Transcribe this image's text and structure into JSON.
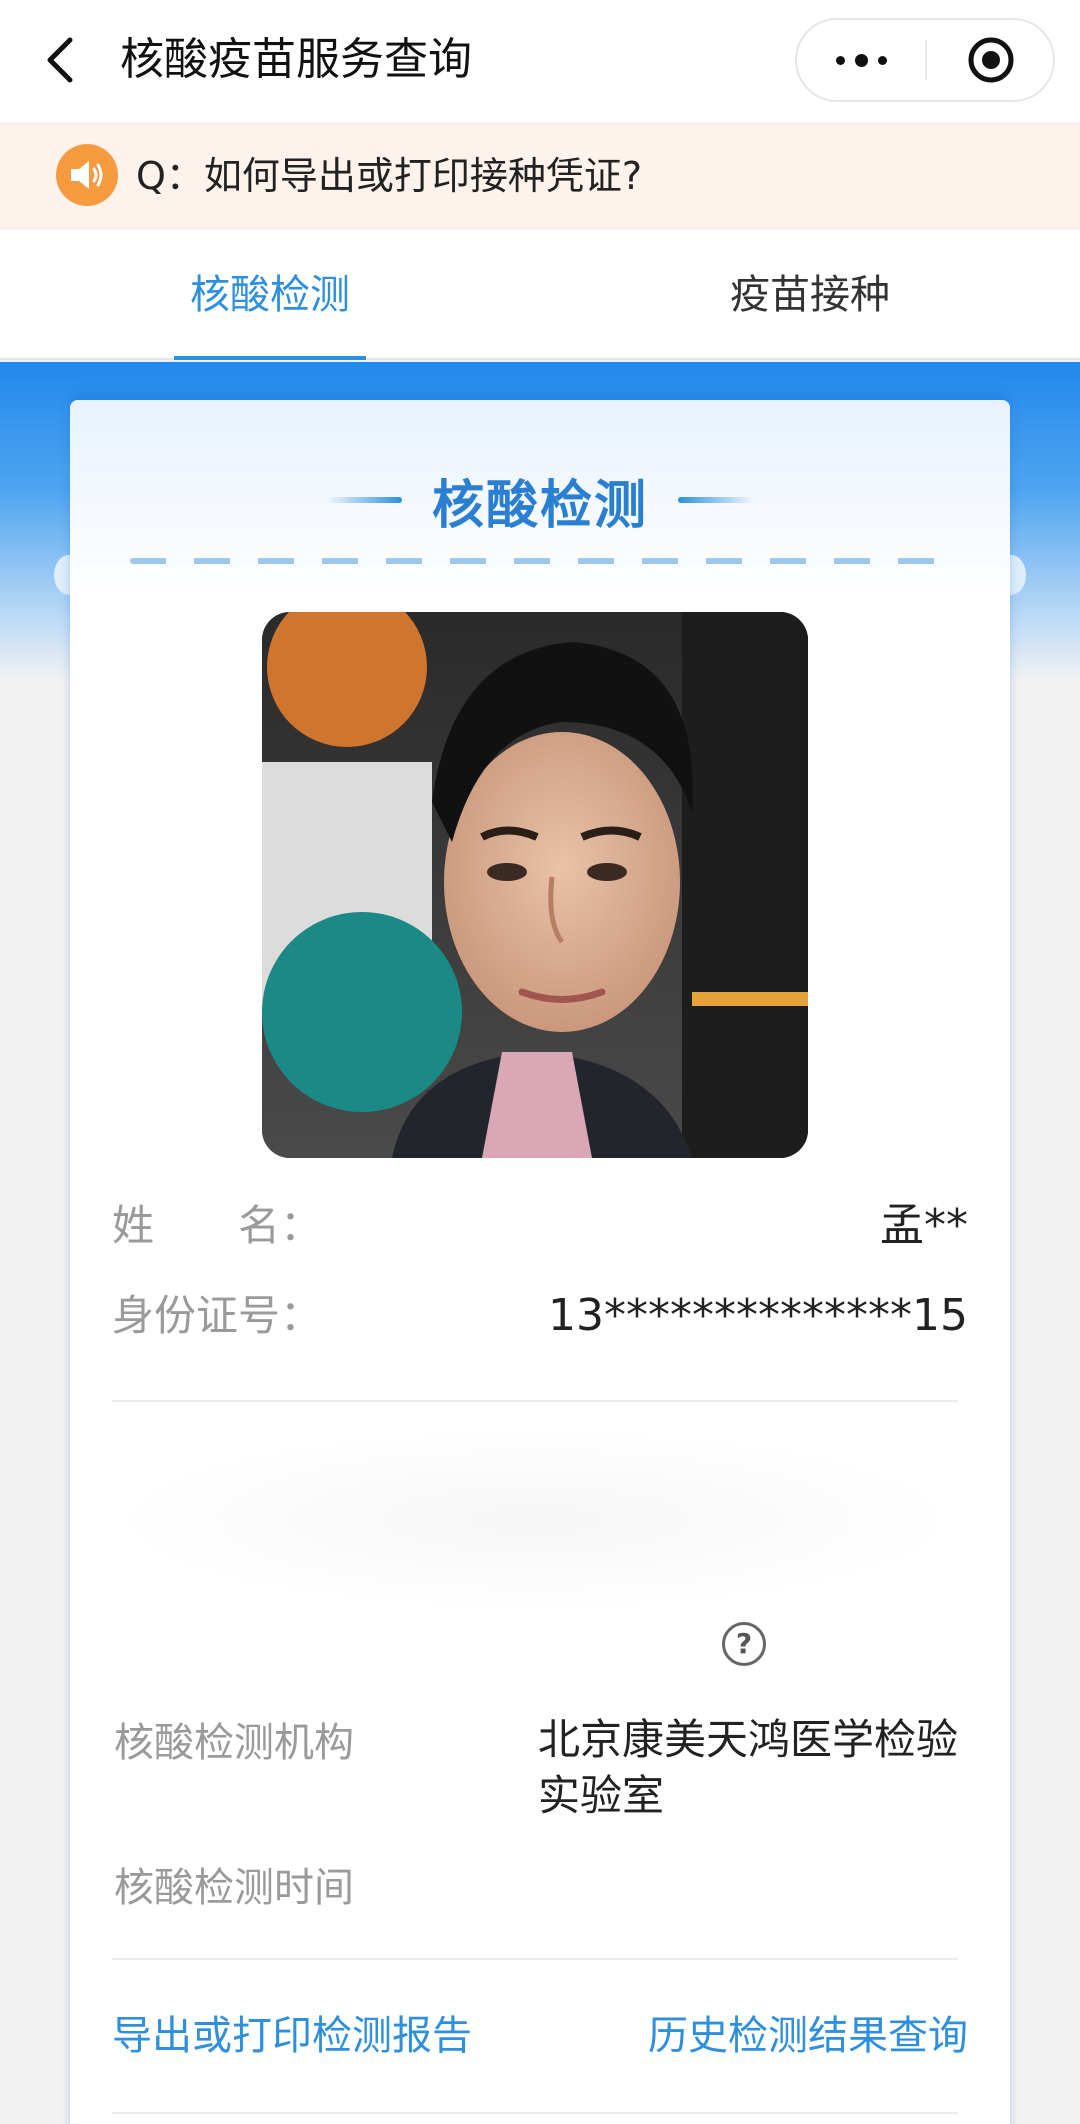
{
  "navbar": {
    "title": "核酸疫苗服务查询",
    "more_icon": "more-dots-icon",
    "close_icon": "target-close-icon"
  },
  "notice": {
    "icon": "speaker-icon",
    "text": "Q：如何导出或打印接种凭证?"
  },
  "tabs": [
    {
      "label": "核酸检测",
      "active": true
    },
    {
      "label": "疫苗接种",
      "active": false
    }
  ],
  "card": {
    "title": "核酸检测",
    "photo": "portrait photo",
    "name_label": "姓　　名：",
    "name_value": "孟**",
    "id_label": "身份证号：",
    "id_value": "13**************15",
    "org_label": "核酸检测机构",
    "org_value": "北京康美天鸿医学检验实验室",
    "time_label": "核酸检测时间",
    "time_value": "",
    "help_icon": "question-circle-icon"
  },
  "actions": {
    "export": "导出或打印检测报告",
    "history": "历史检测结果查询"
  },
  "colors": {
    "accent": "#2e8fde",
    "notice_bg": "#fdf3ec",
    "notice_icon": "#f59a3f",
    "header_blue": "#2289ec"
  }
}
